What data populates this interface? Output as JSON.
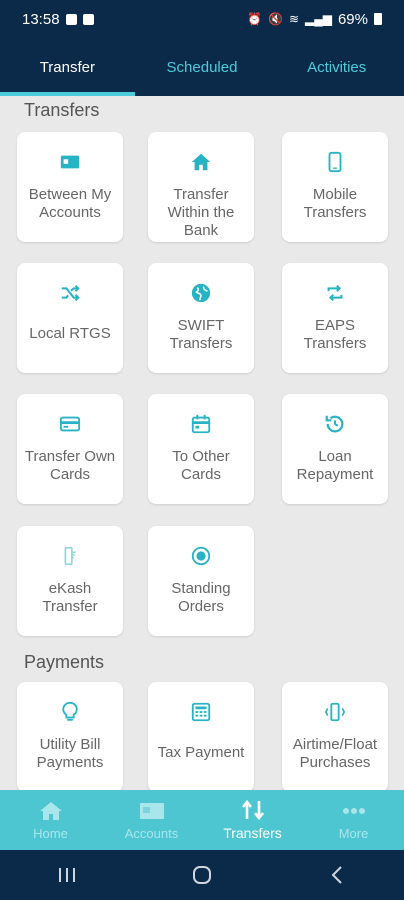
{
  "status_bar": {
    "time": "13:58",
    "battery": "69%"
  },
  "tabs": [
    {
      "label": "Transfer"
    },
    {
      "label": "Scheduled"
    },
    {
      "label": "Activities"
    }
  ],
  "sections": {
    "transfers": {
      "title": "Transfers",
      "items": [
        {
          "label": "Between My Accounts",
          "icon": "account-card-icon"
        },
        {
          "label": "Transfer Within the Bank",
          "icon": "bank-home-icon"
        },
        {
          "label": "Mobile Transfers",
          "icon": "mobile-phone-icon"
        },
        {
          "label": "Local RTGS",
          "icon": "shuffle-icon"
        },
        {
          "label": "SWIFT Transfers",
          "icon": "globe-icon"
        },
        {
          "label": "EAPS Transfers",
          "icon": "repeat-icon"
        },
        {
          "label": "Transfer Own Cards",
          "icon": "credit-card-icon"
        },
        {
          "label": "To Other Cards",
          "icon": "calendar-card-icon"
        },
        {
          "label": "Loan Repayment",
          "icon": "history-icon"
        },
        {
          "label": "eKash Transfer",
          "icon": "ekash-icon"
        },
        {
          "label": "Standing Orders",
          "icon": "standing-order-icon"
        }
      ]
    },
    "payments": {
      "title": "Payments",
      "items": [
        {
          "label": "Utility Bill Payments",
          "icon": "lightbulb-icon"
        },
        {
          "label": "Tax Payment",
          "icon": "calculator-icon"
        },
        {
          "label": "Airtime/Float Purchases",
          "icon": "phone-vibrate-icon"
        }
      ]
    }
  },
  "bottom_nav": [
    {
      "label": "Home"
    },
    {
      "label": "Accounts"
    },
    {
      "label": "Transfers"
    },
    {
      "label": "More"
    }
  ],
  "colors": {
    "primary_dark": "#0b2a4a",
    "accent": "#26b3c4",
    "nav_bg": "#4ec6d2"
  }
}
